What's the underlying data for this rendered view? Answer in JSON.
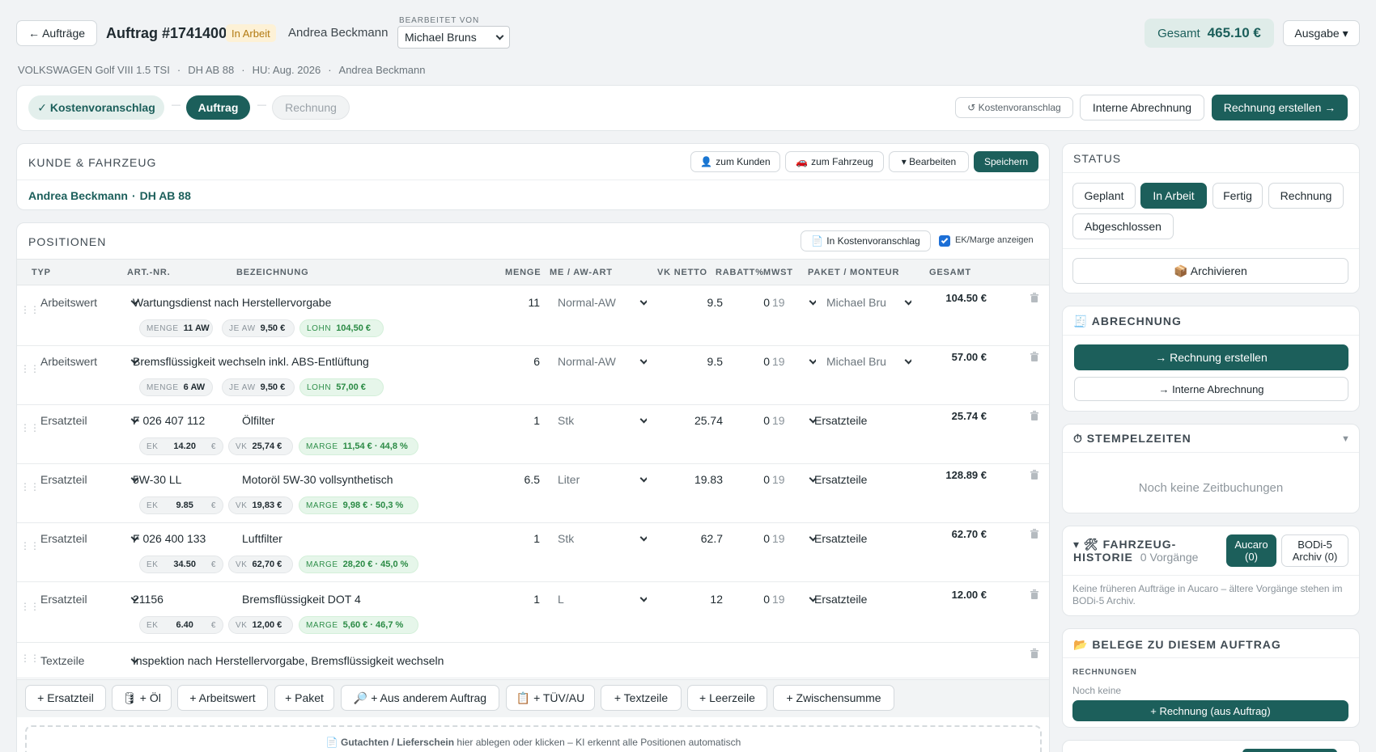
{
  "header": {
    "back_label": "← Aufträge",
    "title": "Auftrag #1741400",
    "status_badge": "In Arbeit",
    "customer": "Andrea Beckmann",
    "edited_by_label": "BEARBEITET VON",
    "edited_by_value": "Michael Bruns",
    "total_label": "Gesamt",
    "total_value": "465.10 €",
    "output_label": "Ausgabe ▾",
    "vehicle_line": [
      "VOLKSWAGEN Golf VIII 1.5 TSI",
      "DH AB 88",
      "HU: Aug. 2026",
      "Andrea Beckmann"
    ]
  },
  "workflow": {
    "steps": [
      "✓ Kostenvoranschlag",
      "Auftrag",
      "Rechnung"
    ],
    "separators": [
      "—",
      "—"
    ],
    "actions": {
      "estimate": "↺ Kostenvoranschlag",
      "internal": "Interne Abrechnung",
      "invoice": "Rechnung erstellen →"
    }
  },
  "customer_card": {
    "title": "KUNDE & FAHRZEUG",
    "buttons": {
      "to_customer": "zum Kunden",
      "to_vehicle": "zum Fahrzeug",
      "edit": "▾ Bearbeiten",
      "save": "Speichern"
    },
    "customer_name": "Andrea Beckmann",
    "separator": "·",
    "plate": "DH AB 88"
  },
  "positions": {
    "title": "POSITIONEN",
    "to_estimate": "In Kostenvoranschlag",
    "show_margin_label": "EK/Marge anzeigen",
    "show_margin_checked": true,
    "columns": [
      "TYP",
      "ART.-NR.",
      "BEZEICHNUNG",
      "MENGE",
      "ME / AW-ART",
      "VK NETTO",
      "RABATT%",
      "MWST",
      "PAKET / MONTEUR",
      "GESAMT"
    ],
    "rows": [
      {
        "type": "Arbeitswert",
        "artnr": "",
        "desc": "Wartungsdienst nach Herstellervorgabe",
        "qty": "11",
        "unit": "Normal-AW",
        "vk": "9.5",
        "discount": "0",
        "vat": "19",
        "assignee": "Michael Bru",
        "total": "104.50 €",
        "chips": [
          {
            "k": "MENGE",
            "v": "11 AW"
          },
          {
            "k": "JE AW",
            "v": "9,50 €"
          },
          {
            "k": "LOHN",
            "v": "104,50 €",
            "green": true
          }
        ]
      },
      {
        "type": "Arbeitswert",
        "artnr": "",
        "desc": "Bremsflüssigkeit wechseln inkl. ABS-Entlüftung",
        "qty": "6",
        "unit": "Normal-AW",
        "vk": "9.5",
        "discount": "0",
        "vat": "19",
        "assignee": "Michael Bru",
        "total": "57.00 €",
        "chips": [
          {
            "k": "MENGE",
            "v": "6 AW"
          },
          {
            "k": "JE AW",
            "v": "9,50 €"
          },
          {
            "k": "LOHN",
            "v": "57,00 €",
            "green": true
          }
        ]
      },
      {
        "type": "Ersatzteil",
        "artnr": "F 026 407 112",
        "desc": "Ölfilter",
        "qty": "1",
        "unit": "Stk",
        "vk": "25.74",
        "discount": "0",
        "vat": "19",
        "assignee": "Ersatzteile",
        "total": "25.74 €",
        "chips": [
          {
            "k": "EK",
            "v": "14.20",
            "suffix": "€"
          },
          {
            "k": "VK",
            "v": "25,74 €"
          },
          {
            "k": "MARGE",
            "v": "11,54 € · 44,8 %",
            "green": true
          }
        ]
      },
      {
        "type": "Ersatzteil",
        "artnr": "5W-30 LL",
        "desc": "Motoröl 5W-30 vollsynthetisch",
        "qty": "6.5",
        "unit": "Liter",
        "vk": "19.83",
        "discount": "0",
        "vat": "19",
        "assignee": "Ersatzteile",
        "total": "128.89 €",
        "chips": [
          {
            "k": "EK",
            "v": "9.85",
            "suffix": "€"
          },
          {
            "k": "VK",
            "v": "19,83 €"
          },
          {
            "k": "MARGE",
            "v": "9,98 € · 50,3 %",
            "green": true
          }
        ]
      },
      {
        "type": "Ersatzteil",
        "artnr": "F 026 400 133",
        "desc": "Luftfilter",
        "qty": "1",
        "unit": "Stk",
        "vk": "62.7",
        "discount": "0",
        "vat": "19",
        "assignee": "Ersatzteile",
        "total": "62.70 €",
        "chips": [
          {
            "k": "EK",
            "v": "34.50",
            "suffix": "€"
          },
          {
            "k": "VK",
            "v": "62,70 €"
          },
          {
            "k": "MARGE",
            "v": "28,20 € · 45,0 %",
            "green": true
          }
        ]
      },
      {
        "type": "Ersatzteil",
        "artnr": "21156",
        "desc": "Bremsflüssigkeit DOT 4",
        "qty": "1",
        "unit": "L",
        "vk": "12",
        "discount": "0",
        "vat": "19",
        "assignee": "Ersatzteile",
        "total": "12.00 €",
        "chips": [
          {
            "k": "EK",
            "v": "6.40",
            "suffix": "€"
          },
          {
            "k": "VK",
            "v": "12,00 €"
          },
          {
            "k": "MARGE",
            "v": "5,60 € · 46,7 %",
            "green": true
          }
        ]
      }
    ],
    "text_row": {
      "type": "Textzeile",
      "desc": "Inspektion nach Herstellervorgabe, Bremsflüssigkeit wechseln"
    },
    "add_buttons": [
      "+ Ersatzteil",
      "🛢 + Öl",
      "+ Arbeitswert",
      "+ Paket",
      "🔎 + Aus anderem Auftrag",
      "📋 + TÜV/AU",
      "+ Textzeile",
      "+ Leerzeile",
      "+ Zwischensumme"
    ],
    "dropzone_bold": "Gutachten / Lieferschein",
    "dropzone_text": "hier ablegen oder klicken – KI erkennt alle Positionen automatisch"
  },
  "sidebar": {
    "status": {
      "title": "STATUS",
      "options": [
        "Geplant",
        "In Arbeit",
        "Fertig",
        "Rechnung",
        "Abgeschlossen"
      ],
      "active": "In Arbeit",
      "archive": "📦 Archivieren"
    },
    "billing": {
      "title": "🧾 ABRECHNUNG",
      "create_invoice": "→ Rechnung erstellen",
      "internal": "→ Interne Abrechnung"
    },
    "time": {
      "title": "⏱ STEMPELZEITEN",
      "empty": "Noch keine Zeitbuchungen"
    },
    "history": {
      "title_line1": "▾ 🛠 FAHRZEUG-",
      "title_line2": "HISTORIE",
      "count": "0 Vorgänge",
      "tab_aucaro": "Aucaro (0)",
      "tab_bodi": "BODi-5 Archiv (0)",
      "note": "Keine früheren Aufträge in Aucaro – ältere Vorgänge stehen im BODi-5 Archiv."
    },
    "documents": {
      "title": "📂 BELEGE ZU DIESEM AUFTRAG",
      "invoices_label": "RECHNUNGEN",
      "none": "Noch keine",
      "add_invoice": "+ Rechnung (aus Auftrag)"
    }
  },
  "colors": {
    "accent": "#1c5f5b",
    "badge_bg": "#fdf1d6",
    "badge_text": "#b27a12",
    "green": "#2a8a44"
  }
}
